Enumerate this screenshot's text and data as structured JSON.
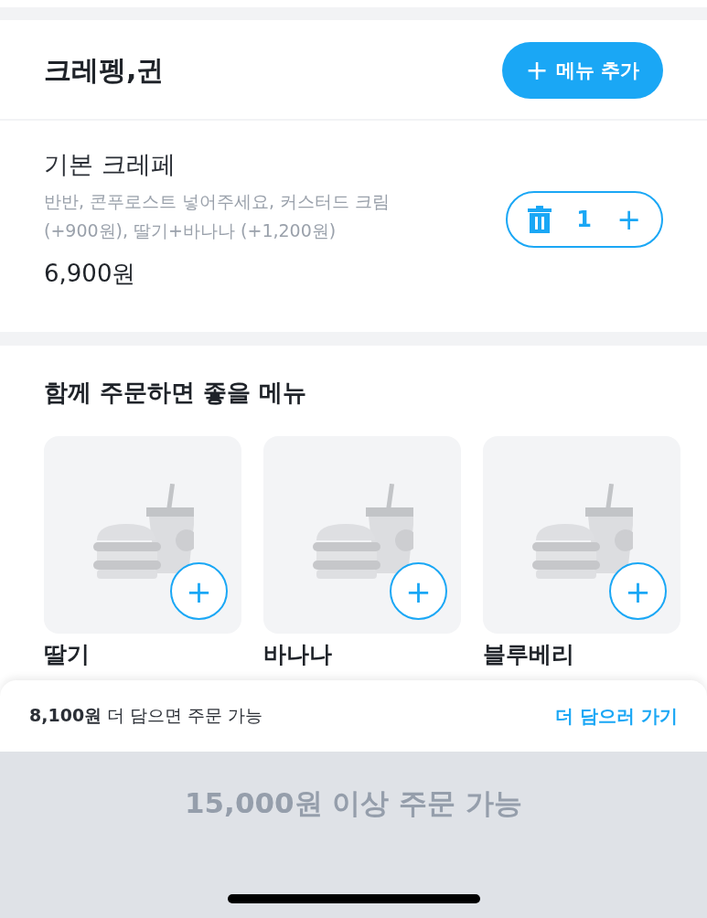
{
  "store": {
    "name": "크레펭,귄",
    "add_button": {
      "icon": "+",
      "label": "메뉴 추가"
    }
  },
  "cart_items": [
    {
      "name": "기본 크레페",
      "options": "반반, 콘푸로스트  넣어주세요, 커스터드 크림 (+900원), 딸기+바나나 (+1,200원)",
      "price": "6,900원",
      "quantity": "1",
      "plus": "+"
    }
  ],
  "recommend": {
    "title": "함께 주문하면 좋을 메뉴",
    "items": [
      {
        "name": "딸기",
        "plus": "+"
      },
      {
        "name": "바나나",
        "plus": "+"
      },
      {
        "name": "블루베리",
        "plus": "+"
      }
    ]
  },
  "bottom_sheet": {
    "notice": "**8,100원** 더 담으면 주문 가능",
    "link": "더 담으러 가기",
    "order_button": {
      "label": "15,000원 이상 주문 가능",
      "disabled": true
    }
  }
}
